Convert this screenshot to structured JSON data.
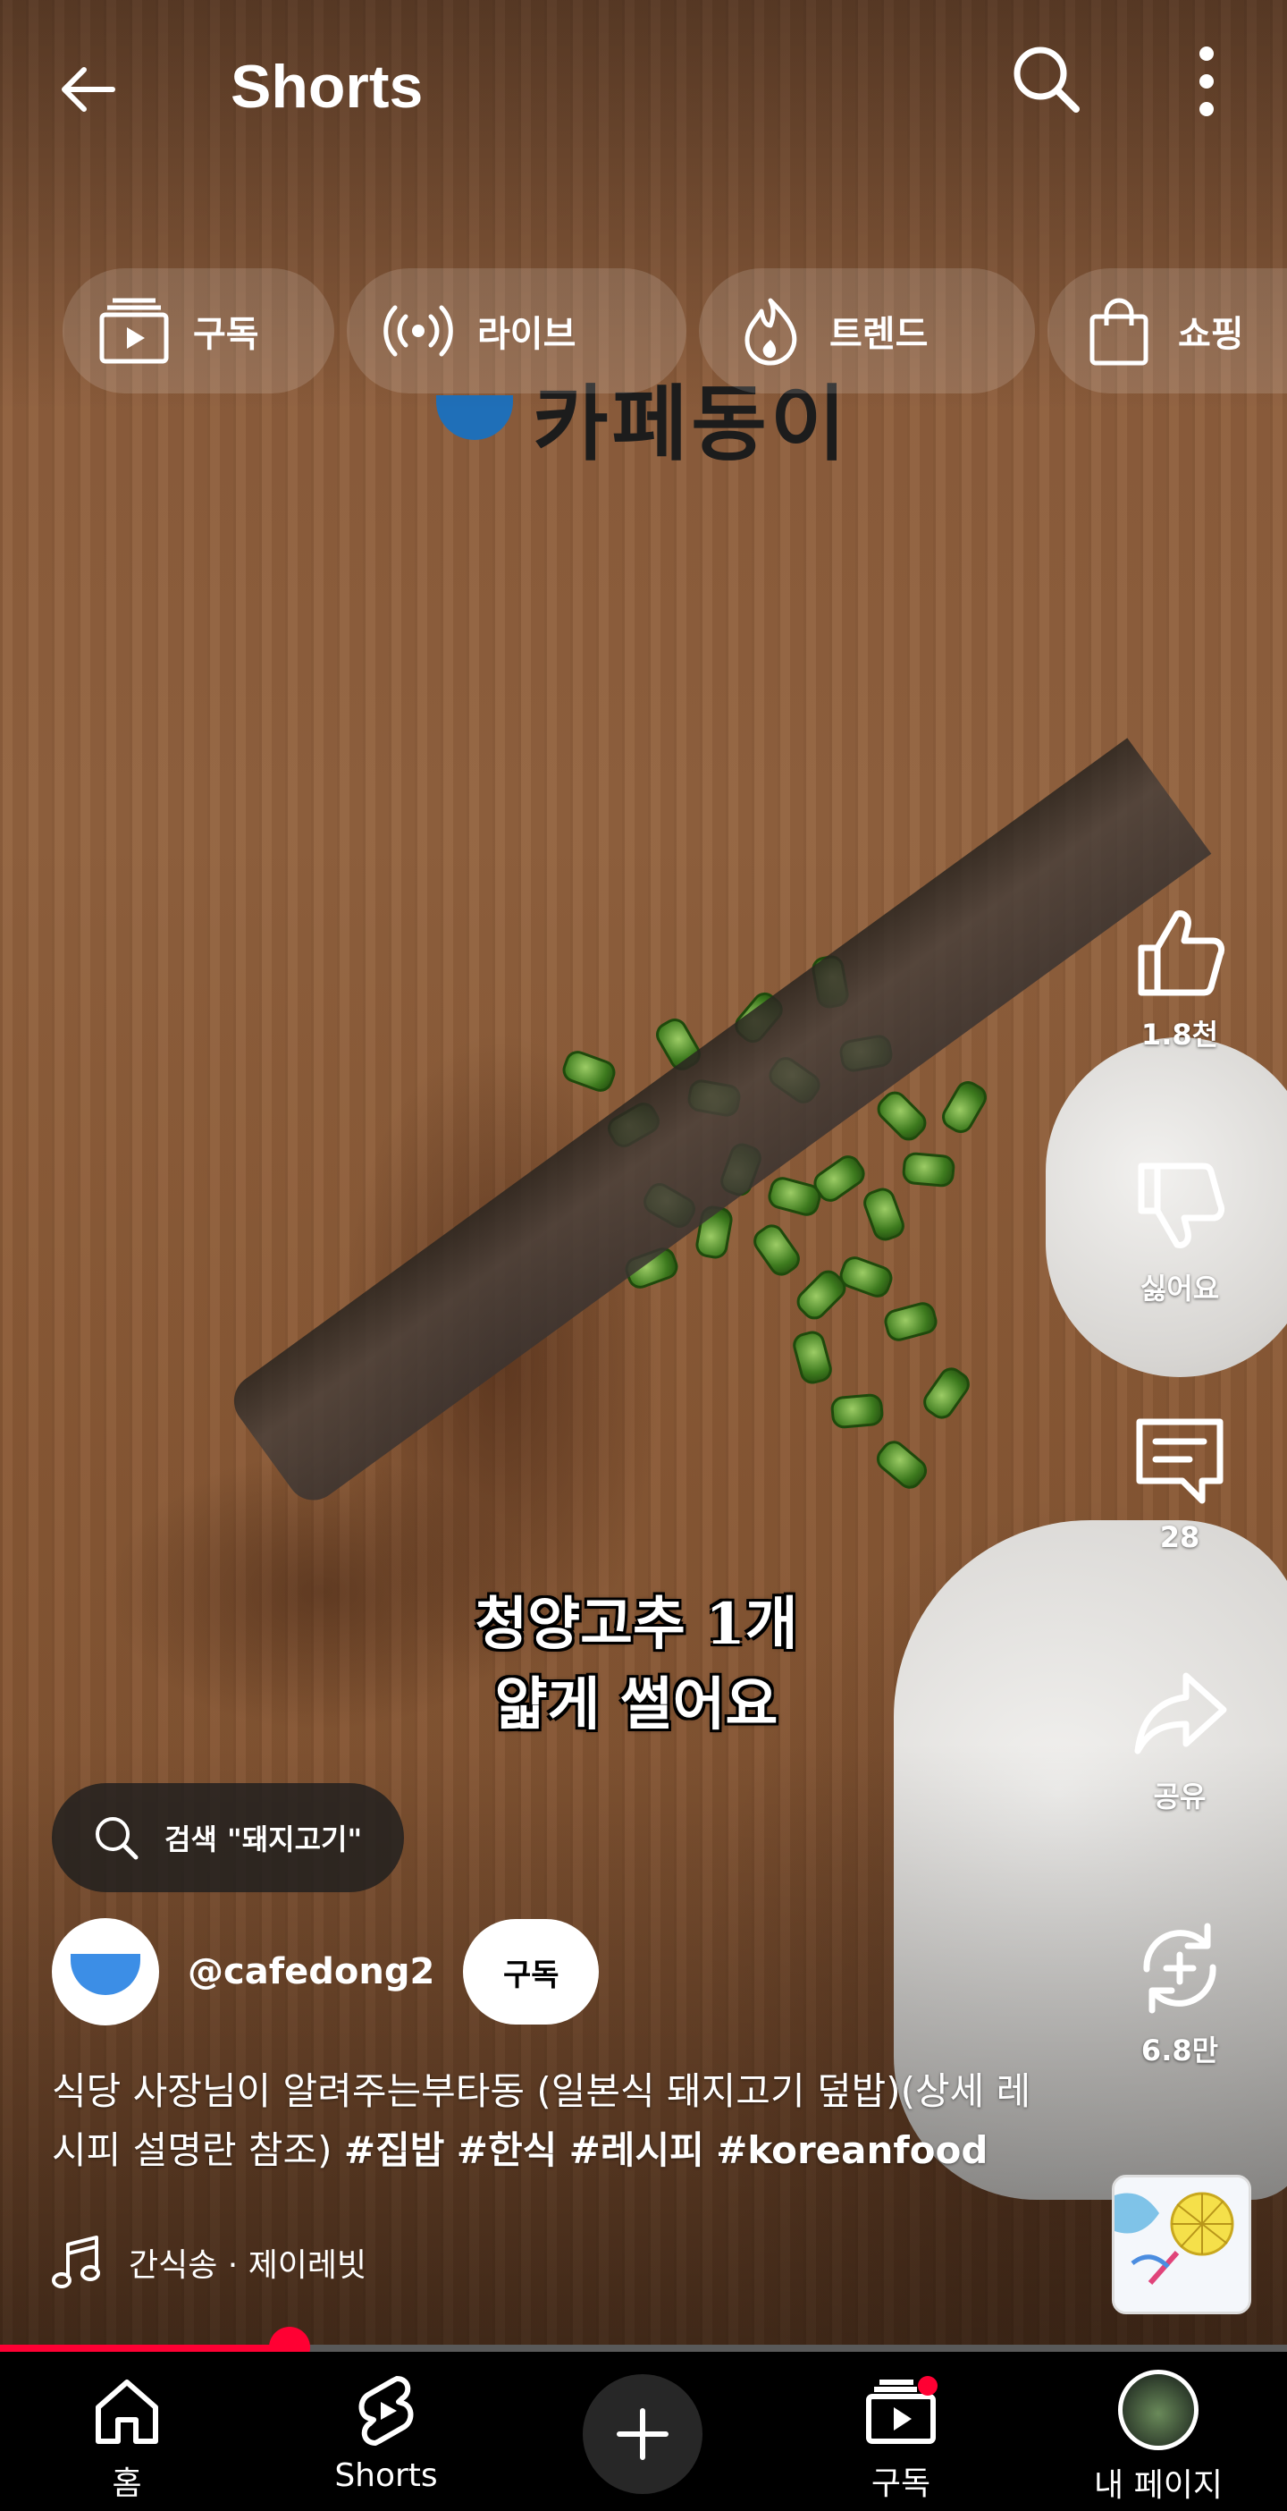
{
  "header": {
    "title": "Shorts"
  },
  "chips": [
    {
      "label": "구독",
      "icon": "subscriptions-icon"
    },
    {
      "label": "라이브",
      "icon": "live-icon"
    },
    {
      "label": "트렌드",
      "icon": "trending-icon"
    },
    {
      "label": "쇼핑",
      "icon": "shopping-bag-icon"
    }
  ],
  "video": {
    "watermark": "카페동이",
    "caption_line1": "청양고추 1개",
    "caption_line2": "얇게 썰어요"
  },
  "actions": {
    "like": "1.8천",
    "dislike": "싫어요",
    "comments": "28",
    "share": "공유",
    "remix": "6.8만"
  },
  "search_chip": {
    "label": "검색 \"돼지고기\""
  },
  "channel": {
    "handle": "@cafedong2",
    "subscribe": "구독"
  },
  "description": {
    "text": "식당 사장님이 알려주는부타동 (일본식 돼지고기 덮밥)(상세 레시피 설명란 참조) ",
    "hashtags": [
      "#집밥",
      "#한식",
      "#레시피",
      "#koreanfood"
    ]
  },
  "music": {
    "label": "간식송 · 제이레빗"
  },
  "progress": {
    "fraction": 0.225
  },
  "nav": {
    "home": "홈",
    "shorts": "Shorts",
    "subscriptions": "구독",
    "mypage": "내 페이지"
  },
  "colors": {
    "accent": "#ff0033",
    "brand_blue": "#3c8ee6"
  }
}
